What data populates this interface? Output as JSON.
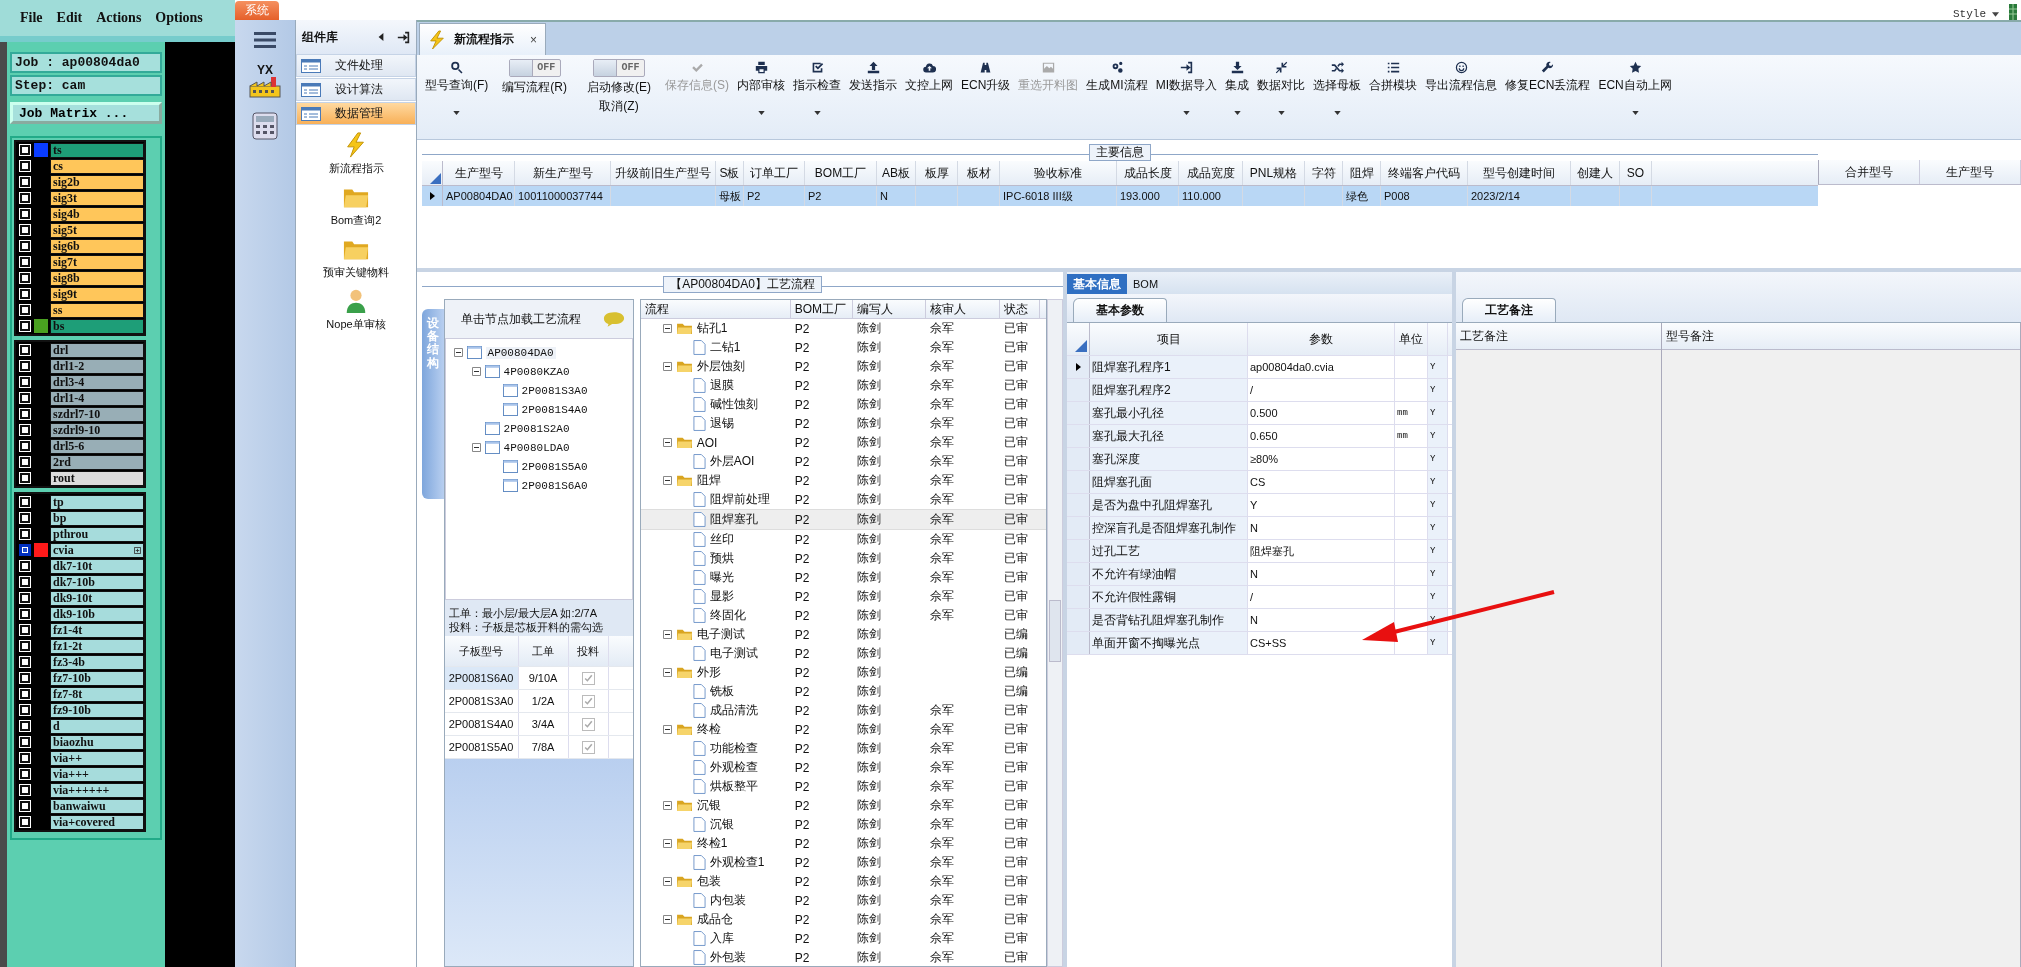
{
  "genesis": {
    "menu": [
      "File",
      "Edit",
      "Actions",
      "Options"
    ],
    "job": "Job : ap00804da0",
    "step": "Step: cam",
    "matrix_button": "Job Matrix ...",
    "layer_groups": [
      [
        {
          "name": "ts",
          "kind": "outer",
          "color": "#0a3cff",
          "selected": false
        },
        {
          "name": "cs",
          "kind": "signal",
          "selected": false
        },
        {
          "name": "sig2b",
          "kind": "signal",
          "selected": false
        },
        {
          "name": "sig3t",
          "kind": "signal",
          "selected": false
        },
        {
          "name": "sig4b",
          "kind": "signal",
          "selected": false
        },
        {
          "name": "sig5t",
          "kind": "signal",
          "selected": false
        },
        {
          "name": "sig6b",
          "kind": "signal",
          "selected": false
        },
        {
          "name": "sig7t",
          "kind": "signal",
          "selected": false
        },
        {
          "name": "sig8b",
          "kind": "signal",
          "selected": false
        },
        {
          "name": "sig9t",
          "kind": "signal",
          "selected": false
        },
        {
          "name": "ss",
          "kind": "signal",
          "selected": false
        },
        {
          "name": "bs",
          "kind": "outer",
          "color": "#4aa020",
          "selected": false
        }
      ],
      [
        {
          "name": "drl",
          "kind": "drill",
          "selected": false
        },
        {
          "name": "drl1-2",
          "kind": "drill",
          "selected": false
        },
        {
          "name": "drl3-4",
          "kind": "drill",
          "selected": false
        },
        {
          "name": "drl1-4",
          "kind": "drill",
          "selected": false
        },
        {
          "name": "szdrl7-10",
          "kind": "drill",
          "selected": false
        },
        {
          "name": "szdrl9-10",
          "kind": "drill",
          "selected": false
        },
        {
          "name": "drl5-6",
          "kind": "drill",
          "selected": false
        },
        {
          "name": "2rd",
          "kind": "drill",
          "selected": false
        },
        {
          "name": "rout",
          "kind": "rout",
          "selected": false
        }
      ],
      [
        {
          "name": "tp",
          "kind": "doc",
          "selected": false
        },
        {
          "name": "bp",
          "kind": "doc",
          "selected": false
        },
        {
          "name": "pthrou",
          "kind": "doc",
          "selected": false
        },
        {
          "name": "cvia",
          "kind": "doc",
          "color": "#ff1a1a",
          "selected": true
        },
        {
          "name": "dk7-10t",
          "kind": "doc",
          "selected": false
        },
        {
          "name": "dk7-10b",
          "kind": "doc",
          "selected": false
        },
        {
          "name": "dk9-10t",
          "kind": "doc",
          "selected": false
        },
        {
          "name": "dk9-10b",
          "kind": "doc",
          "selected": false
        },
        {
          "name": "fz1-4t",
          "kind": "doc",
          "selected": false
        },
        {
          "name": "fz1-2t",
          "kind": "doc",
          "selected": false
        },
        {
          "name": "fz3-4b",
          "kind": "doc",
          "selected": false
        },
        {
          "name": "fz7-10b",
          "kind": "doc",
          "selected": false
        },
        {
          "name": "fz7-8t",
          "kind": "doc",
          "selected": false
        },
        {
          "name": "fz9-10b",
          "kind": "doc",
          "selected": false
        },
        {
          "name": "d",
          "kind": "doc",
          "selected": false
        },
        {
          "name": "biaozhu",
          "kind": "doc",
          "selected": false
        },
        {
          "name": "via++",
          "kind": "doc",
          "selected": false
        },
        {
          "name": "via+++",
          "kind": "doc",
          "selected": false
        },
        {
          "name": "via++++++",
          "kind": "doc",
          "selected": false
        },
        {
          "name": "banwaiwu",
          "kind": "doc",
          "selected": false
        },
        {
          "name": "via+covered",
          "kind": "doc",
          "selected": false
        }
      ]
    ]
  },
  "app": {
    "system_tab": "系统",
    "style_menu": "Style",
    "logo_text": "YX",
    "doc_tab": {
      "title": "新流程指示",
      "close": "×"
    },
    "sidebar": {
      "title": "组件库",
      "groups": [
        {
          "label": "文件处理",
          "selected": false
        },
        {
          "label": "设计算法",
          "selected": false
        },
        {
          "label": "数据管理",
          "selected": true
        }
      ],
      "tools": [
        {
          "label": "新流程指示"
        },
        {
          "label": "Bom查询2"
        },
        {
          "label": "预审关键物料"
        },
        {
          "label": "Nope单审核"
        }
      ]
    },
    "toolbar": [
      {
        "kind": "button",
        "label": "型号查询(F)",
        "dropdown": true,
        "disabled": false
      },
      {
        "kind": "toggle",
        "state_label": "OFF",
        "on": false,
        "label": "编写流程(R)"
      },
      {
        "kind": "toggle",
        "state_label": "OFF",
        "on": false,
        "label": "启动修改(E)",
        "label2": "取消(Z)"
      },
      {
        "kind": "button",
        "label": "保存信息(S)",
        "dropdown": false,
        "disabled": true
      },
      {
        "kind": "button",
        "label": "内部审核",
        "dropdown": true,
        "disabled": false
      },
      {
        "kind": "button",
        "label": "指示检查",
        "dropdown": true,
        "disabled": false
      },
      {
        "kind": "button",
        "label": "发送指示",
        "dropdown": false,
        "disabled": false
      },
      {
        "kind": "button",
        "label": "文控上网",
        "dropdown": false,
        "disabled": false
      },
      {
        "kind": "button",
        "label": "ECN升级",
        "dropdown": false,
        "disabled": false
      },
      {
        "kind": "button",
        "label": "重选开料图",
        "dropdown": false,
        "disabled": true
      },
      {
        "kind": "button",
        "label": "生成MI流程",
        "dropdown": false,
        "disabled": false
      },
      {
        "kind": "button",
        "label": "MI数据导入",
        "dropdown": true,
        "disabled": false
      },
      {
        "kind": "button",
        "label": "集成",
        "dropdown": true,
        "disabled": false
      },
      {
        "kind": "button",
        "label": "数据对比",
        "dropdown": true,
        "disabled": false
      },
      {
        "kind": "button",
        "label": "选择母板",
        "dropdown": true,
        "disabled": false
      },
      {
        "kind": "button",
        "label": "合拼模块",
        "dropdown": false,
        "disabled": false
      },
      {
        "kind": "button",
        "label": "导出流程信息",
        "dropdown": false,
        "disabled": false
      },
      {
        "kind": "button",
        "label": "修复ECN丢流程",
        "dropdown": false,
        "disabled": false
      },
      {
        "kind": "button",
        "label": "ECN自动上网",
        "dropdown": true,
        "disabled": false
      }
    ],
    "main_info": {
      "title": "主要信息",
      "columns": [
        "生产型号",
        "新生产型号",
        "升级前旧生产型号",
        "S板",
        "订单工厂",
        "BOM工厂",
        "AB板",
        "板厚",
        "板材",
        "验收标准",
        "成品长度",
        "成品宽度",
        "PNL规格",
        "字符",
        "阻焊",
        "终端客户代码",
        "型号创建时间",
        "创建人",
        "SO"
      ],
      "rows": [
        {
          "selected": true,
          "cells": [
            "AP00804DA0",
            "10011000037744",
            "",
            "母板",
            "P2",
            "P2",
            "N",
            "",
            "",
            "IPC-6018 III级",
            "193.000",
            "110.000",
            "",
            "",
            "绿色",
            "P008",
            "2023/2/14",
            "",
            ""
          ]
        }
      ],
      "side_columns": [
        "合并型号",
        "生产型号"
      ]
    },
    "process": {
      "title": "【AP00804DA0】工艺流程",
      "side_tab": "设备结构",
      "hint": "单击节点加载工艺流程",
      "tree": [
        {
          "name": "AP00804DA0",
          "expanded": true,
          "children": [
            {
              "name": "4P0080KZA0",
              "expanded": true,
              "children": [
                {
                  "name": "2P0081S3A0"
                },
                {
                  "name": "2P0081S4A0"
                }
              ]
            },
            {
              "name": "2P0081S2A0"
            },
            {
              "name": "4P0080LDA0",
              "expanded": true,
              "children": [
                {
                  "name": "2P0081S5A0"
                },
                {
                  "name": "2P0081S6A0"
                }
              ]
            }
          ]
        }
      ],
      "notes": [
        "工单：最小层/最大层A 如:2/7A",
        "投料：子板是芯板开料的需勾选"
      ],
      "board_columns": [
        "子板型号",
        "工单",
        "投料"
      ],
      "boards": [
        {
          "model": "2P0081S6A0",
          "order": "9/10A",
          "checked": true,
          "selected": true
        },
        {
          "model": "2P0081S3A0",
          "order": "1/2A",
          "checked": true,
          "selected": false
        },
        {
          "model": "2P0081S4A0",
          "order": "3/4A",
          "checked": true,
          "selected": false
        },
        {
          "model": "2P0081S5A0",
          "order": "7/8A",
          "checked": true,
          "selected": false
        }
      ],
      "flow_columns": [
        "流程",
        "BOM工厂",
        "编写人",
        "核审人",
        "状态"
      ],
      "flow": [
        {
          "name": "钻孔1",
          "bom": "P2",
          "writer": "陈剑",
          "reviewer": "佘军",
          "status": "已审",
          "expanded": true,
          "selected": false,
          "children": [
            {
              "name": "二钻1",
              "bom": "P2",
              "writer": "陈剑",
              "reviewer": "佘军",
              "status": "已审",
              "selected": false
            }
          ]
        },
        {
          "name": "外层蚀刻",
          "bom": "P2",
          "writer": "陈剑",
          "reviewer": "佘军",
          "status": "已审",
          "expanded": true,
          "selected": false,
          "children": [
            {
              "name": "退膜",
              "bom": "P2",
              "writer": "陈剑",
              "reviewer": "佘军",
              "status": "已审",
              "selected": false
            },
            {
              "name": "碱性蚀刻",
              "bom": "P2",
              "writer": "陈剑",
              "reviewer": "佘军",
              "status": "已审",
              "selected": false
            },
            {
              "name": "退锡",
              "bom": "P2",
              "writer": "陈剑",
              "reviewer": "佘军",
              "status": "已审",
              "selected": false
            }
          ]
        },
        {
          "name": "AOI",
          "bom": "P2",
          "writer": "陈剑",
          "reviewer": "佘军",
          "status": "已审",
          "expanded": true,
          "selected": false,
          "children": [
            {
              "name": "外层AOI",
              "bom": "P2",
              "writer": "陈剑",
              "reviewer": "佘军",
              "status": "已审",
              "selected": false
            }
          ]
        },
        {
          "name": "阻焊",
          "bom": "P2",
          "writer": "陈剑",
          "reviewer": "佘军",
          "status": "已审",
          "expanded": true,
          "selected": false,
          "children": [
            {
              "name": "阻焊前处理",
              "bom": "P2",
              "writer": "陈剑",
              "reviewer": "佘军",
              "status": "已审",
              "selected": false
            },
            {
              "name": "阻焊塞孔",
              "bom": "P2",
              "writer": "陈剑",
              "reviewer": "佘军",
              "status": "已审",
              "selected": true
            },
            {
              "name": "丝印",
              "bom": "P2",
              "writer": "陈剑",
              "reviewer": "佘军",
              "status": "已审",
              "selected": false
            },
            {
              "name": "预烘",
              "bom": "P2",
              "writer": "陈剑",
              "reviewer": "佘军",
              "status": "已审",
              "selected": false
            },
            {
              "name": "曝光",
              "bom": "P2",
              "writer": "陈剑",
              "reviewer": "佘军",
              "status": "已审",
              "selected": false
            },
            {
              "name": "显影",
              "bom": "P2",
              "writer": "陈剑",
              "reviewer": "佘军",
              "status": "已审",
              "selected": false
            },
            {
              "name": "终固化",
              "bom": "P2",
              "writer": "陈剑",
              "reviewer": "佘军",
              "status": "已审",
              "selected": false
            }
          ]
        },
        {
          "name": "电子测试",
          "bom": "P2",
          "writer": "陈剑",
          "status": "已编",
          "expanded": true,
          "selected": false,
          "children": [
            {
              "name": "电子测试",
              "bom": "P2",
              "writer": "陈剑",
              "status": "已编",
              "selected": false
            }
          ]
        },
        {
          "name": "外形",
          "bom": "P2",
          "writer": "陈剑",
          "status": "已编",
          "expanded": true,
          "selected": false,
          "children": [
            {
              "name": "铣板",
              "bom": "P2",
              "writer": "陈剑",
              "status": "已编",
              "selected": false
            },
            {
              "name": "成品清洗",
              "bom": "P2",
              "writer": "陈剑",
              "reviewer": "佘军",
              "status": "已审",
              "selected": false
            }
          ]
        },
        {
          "name": "终检",
          "bom": "P2",
          "writer": "陈剑",
          "reviewer": "佘军",
          "status": "已审",
          "expanded": true,
          "selected": false,
          "children": [
            {
              "name": "功能检查",
              "bom": "P2",
              "writer": "陈剑",
              "reviewer": "佘军",
              "status": "已审",
              "selected": false
            },
            {
              "name": "外观检查",
              "bom": "P2",
              "writer": "陈剑",
              "reviewer": "佘军",
              "status": "已审",
              "selected": false
            },
            {
              "name": "烘板整平",
              "bom": "P2",
              "writer": "陈剑",
              "reviewer": "佘军",
              "status": "已审",
              "selected": false
            }
          ]
        },
        {
          "name": "沉银",
          "bom": "P2",
          "writer": "陈剑",
          "reviewer": "佘军",
          "status": "已审",
          "expanded": true,
          "selected": false,
          "children": [
            {
              "name": "沉银",
              "bom": "P2",
              "writer": "陈剑",
              "reviewer": "佘军",
              "status": "已审",
              "selected": false
            }
          ]
        },
        {
          "name": "终检1",
          "bom": "P2",
          "writer": "陈剑",
          "reviewer": "佘军",
          "status": "已审",
          "expanded": true,
          "selected": false,
          "children": [
            {
              "name": "外观检查1",
              "bom": "P2",
              "writer": "陈剑",
              "reviewer": "佘军",
              "status": "已审",
              "selected": false
            }
          ]
        },
        {
          "name": "包装",
          "bom": "P2",
          "writer": "陈剑",
          "reviewer": "佘军",
          "status": "已审",
          "expanded": true,
          "selected": false,
          "children": [
            {
              "name": "内包装",
              "bom": "P2",
              "writer": "陈剑",
              "reviewer": "佘军",
              "status": "已审",
              "selected": false
            }
          ]
        },
        {
          "name": "成品仓",
          "bom": "P2",
          "writer": "陈剑",
          "reviewer": "佘军",
          "status": "已审",
          "expanded": true,
          "selected": false,
          "children": [
            {
              "name": "入库",
              "bom": "P2",
              "writer": "陈剑",
              "reviewer": "佘军",
              "status": "已审",
              "selected": false
            },
            {
              "name": "外包装",
              "bom": "P2",
              "writer": "陈剑",
              "reviewer": "佘军",
              "status": "已审",
              "selected": false
            }
          ]
        }
      ]
    },
    "basic": {
      "tabs": [
        {
          "label": "基本信息",
          "selected": true
        },
        {
          "label": "BOM",
          "selected": false
        }
      ],
      "sub_tab": "基本参数",
      "columns": [
        "项目",
        "参数",
        "单位"
      ],
      "rows": [
        {
          "item": "阻焊塞孔程序1",
          "value": "ap00804da0.cvia",
          "flag": "Y",
          "current": true
        },
        {
          "item": "阻焊塞孔程序2",
          "value": "/",
          "flag": "Y",
          "current": false
        },
        {
          "item": "塞孔最小孔径",
          "value": "0.500",
          "unit": "mm",
          "flag": "Y",
          "current": false
        },
        {
          "item": "塞孔最大孔径",
          "value": "0.650",
          "unit": "mm",
          "flag": "Y",
          "current": false
        },
        {
          "item": "塞孔深度",
          "value": "≥80%",
          "flag": "Y",
          "current": false
        },
        {
          "item": "阻焊塞孔面",
          "value": "CS",
          "flag": "Y",
          "current": false
        },
        {
          "item": "是否为盘中孔阻焊塞孔",
          "value": "Y",
          "flag": "Y",
          "current": false
        },
        {
          "item": "控深盲孔是否阻焊塞孔制作",
          "value": "N",
          "flag": "Y",
          "current": false
        },
        {
          "item": "过孔工艺",
          "value": "阻焊塞孔",
          "flag": "Y",
          "current": false
        },
        {
          "item": "不允许有绿油帽",
          "value": "N",
          "flag": "Y",
          "current": false
        },
        {
          "item": "不允许假性露铜",
          "value": "/",
          "flag": "Y",
          "current": false
        },
        {
          "item": "是否背钻孔阻焊塞孔制作",
          "value": "N",
          "flag": "Y",
          "current": false
        },
        {
          "item": "单面开窗不掏曝光点",
          "value": "CS+SS",
          "flag": "Y",
          "current": false
        }
      ]
    },
    "remarks": {
      "tab": "工艺备注",
      "columns": [
        "工艺备注",
        "型号备注"
      ]
    }
  }
}
